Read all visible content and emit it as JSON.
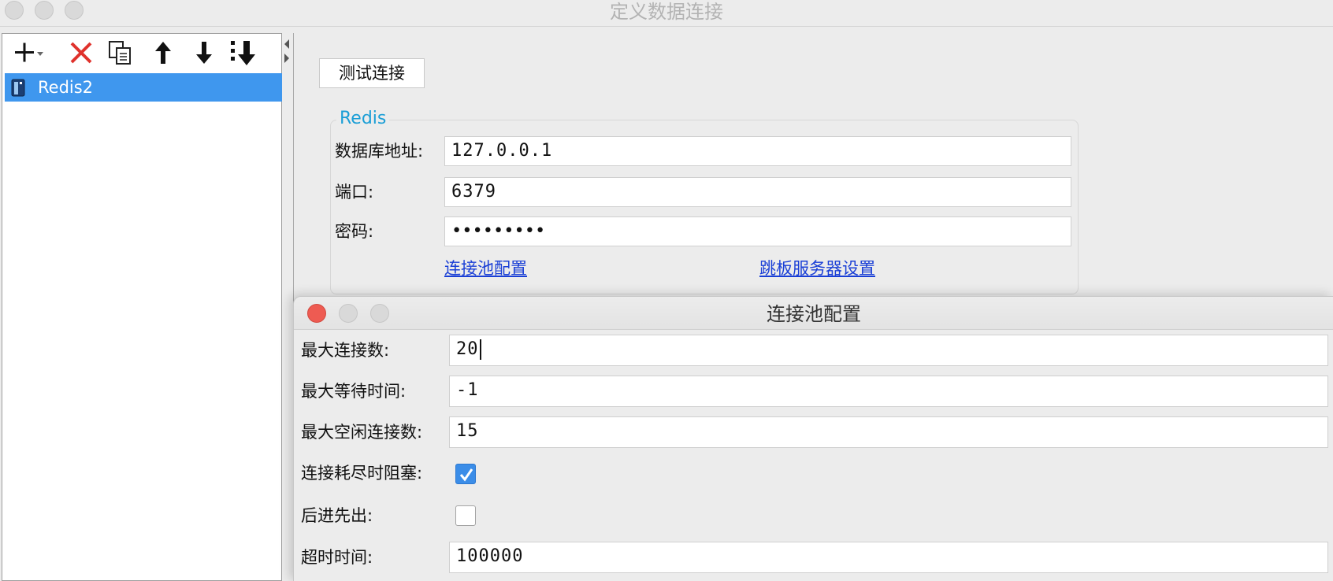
{
  "window": {
    "title": "定义数据连接"
  },
  "toolbar": {
    "buttons": [
      {
        "name": "add",
        "icon": "plus-dropdown-icon"
      },
      {
        "name": "delete",
        "icon": "red-x-icon"
      },
      {
        "name": "copy",
        "icon": "copy-icon"
      },
      {
        "name": "move-up",
        "icon": "arrow-up-icon"
      },
      {
        "name": "move-down",
        "icon": "arrow-down-icon"
      },
      {
        "name": "move-bottom",
        "icon": "move-to-bottom-icon"
      }
    ]
  },
  "tree": {
    "items": [
      {
        "label": "Redis2",
        "icon": "redis-icon",
        "selected": true
      }
    ]
  },
  "main": {
    "test_button": "测试连接",
    "group_title": "Redis",
    "address_label": "数据库地址:",
    "address_value": "127.0.0.1",
    "port_label": "端口:",
    "port_value": "6379",
    "password_label": "密码:",
    "password_value": "•••••••••",
    "pool_link": "连接池配置",
    "jump_link": "跳板服务器设置"
  },
  "dialog": {
    "title": "连接池配置",
    "max_conn_label": "最大连接数:",
    "max_conn_value": "20",
    "max_wait_label": "最大等待时间:",
    "max_wait_value": "-1",
    "max_idle_label": "最大空闲连接数:",
    "max_idle_value": "15",
    "block_label": "连接耗尽时阻塞:",
    "block_checked": true,
    "lifo_label": "后进先出:",
    "lifo_checked": false,
    "timeout_label": "超时时间:",
    "timeout_value": "100000"
  },
  "colors": {
    "selection": "#3f97ee",
    "group_title": "#1a9ed6",
    "link": "#1a3fd6",
    "close_button": "#ee5b52",
    "checkbox_checked": "#3b8de8"
  }
}
